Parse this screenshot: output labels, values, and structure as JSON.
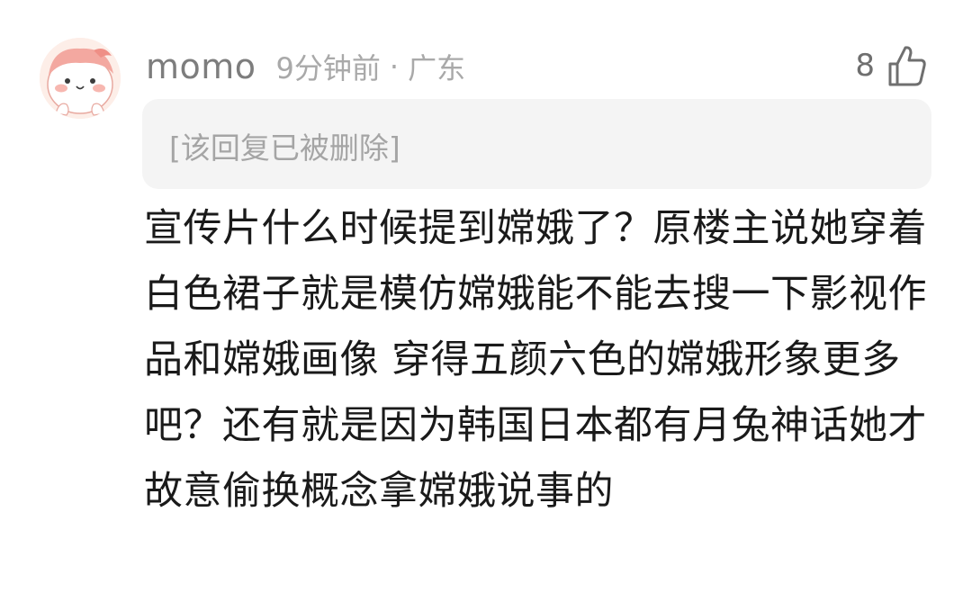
{
  "comment": {
    "username": "momo",
    "time_ago": "9分钟前",
    "separator": "·",
    "location": "广东",
    "like_count": "8",
    "quoted_reply": "[该回复已被删除]",
    "text": "宣传片什么时候提到嫦娥了？原楼主说她穿着白色裙子就是模仿嫦娥能不能去搜一下影视作品和嫦娥画像 穿得五颜六色的嫦娥形象更多吧？还有就是因为韩国日本都有月兔神话她才故意偷换概念拿嫦娥说事的",
    "avatar_icon": "cartoon-avatar-icon",
    "like_icon": "thumbs-up-icon"
  },
  "colors": {
    "username": "#7d7d7d",
    "meta": "#a9a9a9",
    "quote_bg": "#f4f4f4",
    "quote_text": "#a5a5a5",
    "body_text": "#1a1a1a"
  }
}
